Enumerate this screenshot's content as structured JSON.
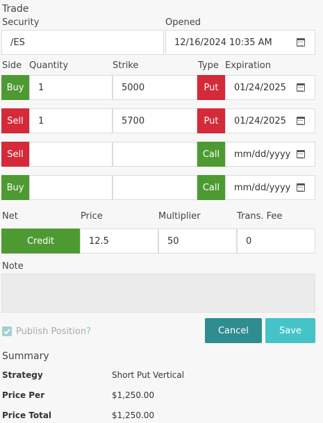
{
  "trade": {
    "section_title": "Trade",
    "security_label": "Security",
    "security_value": "/ES",
    "opened_label": "Opened",
    "opened_value": "12/16/2024 10:35  AM"
  },
  "legs_header": {
    "side": "Side",
    "quantity": "Quantity",
    "strike": "Strike",
    "type": "Type",
    "expiration": "Expiration"
  },
  "legs": [
    {
      "side": "Buy",
      "quantity": "1",
      "strike": "5000",
      "type": "Put",
      "expiration": "01/24/2025",
      "side_color": "#4e9a32",
      "type_color": "#d42a3a"
    },
    {
      "side": "Sell",
      "quantity": "1",
      "strike": "5700",
      "type": "Put",
      "expiration": "01/24/2025",
      "side_color": "#d42a3a",
      "type_color": "#d42a3a"
    },
    {
      "side": "Sell",
      "quantity": "",
      "strike": "",
      "type": "Call",
      "expiration": "mm/dd/yyyy",
      "side_color": "#d42a3a",
      "type_color": "#4e9a32"
    },
    {
      "side": "Buy",
      "quantity": "",
      "strike": "",
      "type": "Call",
      "expiration": "mm/dd/yyyy",
      "side_color": "#4e9a32",
      "type_color": "#4e9a32"
    }
  ],
  "pricing": {
    "net_label": "Net",
    "net_value": "Credit",
    "price_label": "Price",
    "price_value": "12.5",
    "multiplier_label": "Multiplier",
    "multiplier_value": "50",
    "fee_label": "Trans. Fee",
    "fee_value": "0"
  },
  "note": {
    "label": "Note",
    "value": ""
  },
  "publish": {
    "label": "Publish Position",
    "help": "?",
    "checked": true
  },
  "actions": {
    "cancel": "Cancel",
    "save": "Save"
  },
  "summary": {
    "title": "Summary",
    "rows": [
      {
        "label": "Strategy",
        "value": "Short Put Vertical"
      },
      {
        "label": "Price Per",
        "value": "$1,250.00"
      },
      {
        "label": "Price Total",
        "value": "$1,250.00"
      }
    ]
  },
  "colors": {
    "buy": "#4e9a32",
    "sell": "#d42a3a",
    "cancel": "#2f8d90",
    "save": "#45c3c9"
  }
}
